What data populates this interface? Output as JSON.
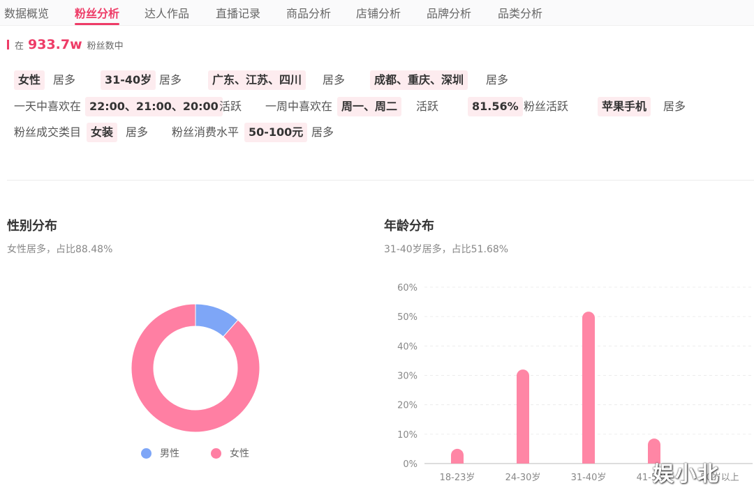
{
  "tabs": [
    "数据概览",
    "粉丝分析",
    "达人作品",
    "直播记录",
    "商品分析",
    "店铺分析",
    "品牌分析",
    "品类分析"
  ],
  "active_tab": "粉丝分析",
  "fans": {
    "prefix": "在",
    "count": "933.7w",
    "suffix": "粉丝数中"
  },
  "tags": {
    "row1": [
      {
        "chip": "女性",
        "text": "居多"
      },
      {
        "chip": "31-40岁",
        "text": "居多"
      },
      {
        "chip": "广东、江苏、四川",
        "text": "居多"
      },
      {
        "chip": "成都、重庆、深圳",
        "text": "居多"
      }
    ],
    "row2": [
      {
        "pre": "一天中喜欢在",
        "chip": "22:00、21:00、20:00",
        "text": "活跃"
      },
      {
        "pre": "一周中喜欢在",
        "chip": "周一、周二",
        "text": "活跃"
      },
      {
        "pre": "",
        "chip": "81.56%",
        "text": "粉丝活跃"
      },
      {
        "pre": "",
        "chip": "苹果手机",
        "text": "居多"
      }
    ],
    "row3": [
      {
        "pre": "粉丝成交类目",
        "chip": "女装",
        "text": "居多"
      },
      {
        "pre": "粉丝消费水平",
        "chip": "50-100元",
        "text": "居多"
      }
    ]
  },
  "gender": {
    "title": "性别分布",
    "subtitle": "女性居多，占比88.48%",
    "legend": [
      {
        "name": "男性",
        "color": "#7ea6f7"
      },
      {
        "name": "女性",
        "color": "#ff7fa3"
      }
    ]
  },
  "age": {
    "title": "年龄分布",
    "subtitle": "31-40岁居多，占比51.68%"
  },
  "watermark": "娱小北",
  "colors": {
    "accent": "#ee3c67",
    "male": "#7ea6f7",
    "female": "#ff7fa3",
    "bar": "#ff86a5"
  },
  "chart_data": [
    {
      "type": "pie",
      "title": "性别分布",
      "categories": [
        "男性",
        "女性"
      ],
      "values": [
        11.52,
        88.48
      ]
    },
    {
      "type": "bar",
      "title": "年龄分布",
      "categories": [
        "18-23岁",
        "24-30岁",
        "31-40岁",
        "41-50岁",
        "50岁以上"
      ],
      "values": [
        5,
        32,
        51.68,
        8.5,
        0
      ],
      "ylim": [
        0,
        60
      ],
      "yticks": [
        "0%",
        "10%",
        "20%",
        "30%",
        "40%",
        "50%",
        "60%"
      ],
      "grid": true
    }
  ]
}
